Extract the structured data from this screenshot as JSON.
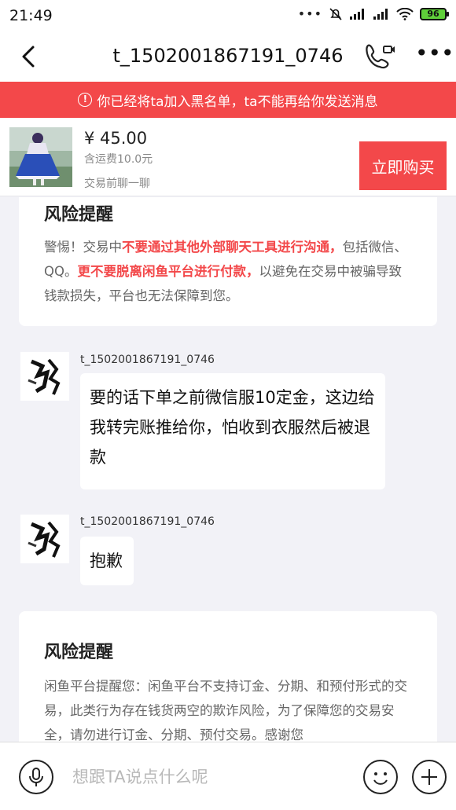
{
  "status_bar": {
    "time": "21:49",
    "battery": "96"
  },
  "header": {
    "title": "t_1502001867191_0746"
  },
  "banner": {
    "text": "你已经将ta加入黑名单，ta不能再给你发送消息"
  },
  "product": {
    "price": "¥ 45.00",
    "shipping": "含运费10.0元",
    "note": "交易前聊一聊",
    "buy_label": "立即购买"
  },
  "risk1": {
    "title": "风险提醒",
    "p1": "警惕！交易中",
    "p2": "不要通过其他外部聊天工具进行沟通，",
    "p3": "包括微信、QQ。",
    "p4": "更不要脱离闲鱼平台进行付款，",
    "p5": "以避免在交易中被骗导致钱款损失，平台也无法保障到您。"
  },
  "messages": [
    {
      "sender": "t_1502001867191_0746",
      "text": "要的话下单之前微信服10定金，这边给我转完账推给你，怕收到衣服然后被退款"
    },
    {
      "sender": "t_1502001867191_0746",
      "text": "抱歉"
    }
  ],
  "risk2": {
    "title": "风险提醒",
    "text": "闲鱼平台提醒您：闲鱼平台不支持订金、分期、和预付形式的交易，此类行为存在钱货两空的欺诈风险，为了保障您的交易安全，请勿进行订金、分期、预付交易。感谢您"
  },
  "input": {
    "placeholder": "想跟TA说点什么呢"
  },
  "colors": {
    "accent": "#f3484a",
    "chat_bg": "#f2f2f7"
  },
  "icons": [
    "back-icon",
    "video-call-icon",
    "more-icon",
    "alert-icon",
    "mic-icon",
    "emoji-icon",
    "plus-icon"
  ]
}
